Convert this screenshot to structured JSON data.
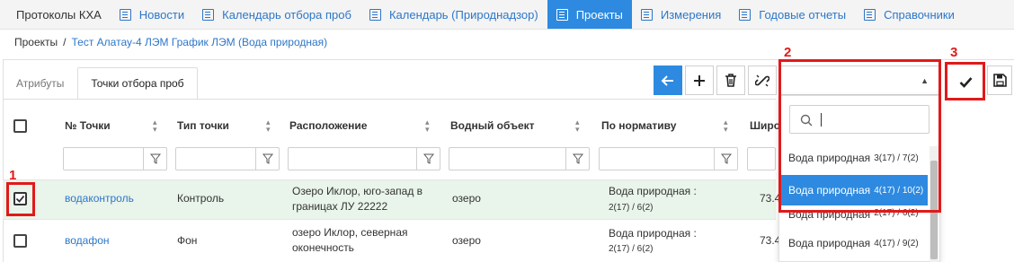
{
  "topnav": {
    "brand": "Протоколы КХА",
    "items": [
      {
        "label": "Новости"
      },
      {
        "label": "Календарь отбора проб"
      },
      {
        "label": "Календарь (Природнадзор)"
      },
      {
        "label": "Проекты"
      },
      {
        "label": "Измерения"
      },
      {
        "label": "Годовые отчеты"
      },
      {
        "label": "Справочники"
      }
    ],
    "active_index": 3
  },
  "breadcrumb": {
    "root": "Проекты",
    "sep": "/",
    "current": "Тест Алатау-4 ЛЭМ График ЛЭМ (Вода природная)"
  },
  "tabs": [
    {
      "label": "Атрибуты"
    },
    {
      "label": "Точки отбора проб"
    }
  ],
  "table": {
    "headers": [
      "№ Точки",
      "Тип точки",
      "Расположение",
      "Водный объект",
      "По нормативу",
      "Широ"
    ],
    "rows": [
      {
        "checked": true,
        "point": "водаконтроль",
        "type": "Контроль",
        "location_1": "Озеро Иклор, юго-запад в",
        "location_2": "границах ЛУ 22222",
        "water": "озеро",
        "norm_1": "Вода природная :",
        "norm_2": "2(17) / 6(2)",
        "lat": "73.4"
      },
      {
        "checked": false,
        "point": "водафон",
        "type": "Фон",
        "location_1": "озеро Иклор, северная",
        "location_2": "оконечность",
        "water": "озеро",
        "norm_1": "Вода природная :",
        "norm_2": "2(17) / 6(2)",
        "lat": "73.4"
      }
    ]
  },
  "dropdown": {
    "search_value": "",
    "options": [
      {
        "label": "Вода природная",
        "count": "3(17) / 7(2)"
      },
      {
        "label": "Вода природная",
        "count": "4(17) / 10(2)"
      },
      {
        "label": "Вода природная",
        "count": "2(17) / 6(2)"
      },
      {
        "label": "Вода природная",
        "count": "4(17) / 9(2)"
      }
    ],
    "selected_index": 1
  },
  "annotations": {
    "one": "1",
    "two": "2",
    "three": "3"
  },
  "colors": {
    "accent": "#2d8ae0",
    "link": "#2d77c9",
    "annotation": "#e01a1a",
    "selected_row": "#e9f4ea"
  }
}
